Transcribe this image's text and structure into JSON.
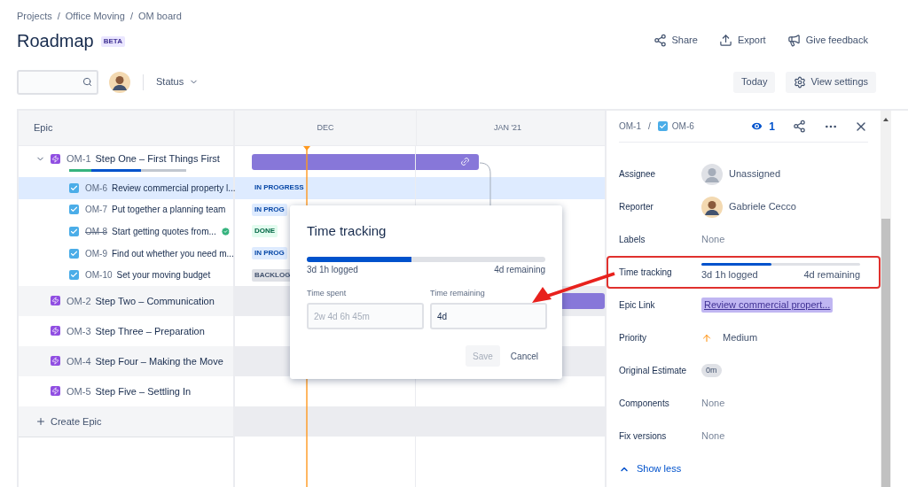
{
  "breadcrumbs": [
    "Projects",
    "Office Moving",
    "OM board"
  ],
  "breadcrumb_separators": [
    "/",
    "/"
  ],
  "title": "Roadmap",
  "badge": "BETA",
  "header_actions": [
    {
      "kind": "share",
      "label": "Share"
    },
    {
      "kind": "export",
      "label": "Export"
    },
    {
      "kind": "feedback",
      "label": "Give feedback"
    }
  ],
  "toolbar": {
    "filter": "Status",
    "buttons": [
      {
        "kind": "today",
        "label": "Today"
      },
      {
        "kind": "settings",
        "label": "View settings"
      }
    ]
  },
  "roadmap": {
    "column": "Epic",
    "months": [
      "DEC",
      "JAN '21"
    ],
    "epics": [
      {
        "key": "OM-1",
        "title": "Step One – First Things First",
        "expanded": true,
        "has_bar": true,
        "progress": [
          {
            "kind": "done",
            "level": 0.19
          },
          {
            "kind": "in_progress",
            "level": 0.42
          }
        ],
        "children": [
          {
            "key": "OM-6",
            "title": "Review commercial property l...",
            "selected": true,
            "resolved": false,
            "status": {
              "kind": "in_progress",
              "label": "IN PROGRESS"
            }
          },
          {
            "key": "OM-7",
            "title": "Put together a planning team",
            "selected": false,
            "resolved": false,
            "status": {
              "kind": "in_progress",
              "label": "IN PROG"
            }
          },
          {
            "key": "OM-8",
            "title": "Start getting quotes from...",
            "selected": false,
            "resolved": true,
            "status": {
              "kind": "done",
              "label": "DONE"
            }
          },
          {
            "key": "OM-9",
            "title": "Find out whether you need m...",
            "selected": false,
            "resolved": false,
            "status": {
              "kind": "in_progress",
              "label": "IN PROG"
            }
          },
          {
            "key": "OM-10",
            "title": "Set your moving budget",
            "selected": false,
            "resolved": false,
            "status": {
              "kind": "backlog",
              "label": "BACKLOG"
            }
          }
        ]
      },
      {
        "key": "OM-2",
        "title": "Step Two – Communication",
        "expanded": false,
        "has_bar": true
      },
      {
        "key": "OM-3",
        "title": "Step Three – Preparation",
        "expanded": false
      },
      {
        "key": "OM-4",
        "title": "Step Four – Making the Move",
        "expanded": false
      },
      {
        "key": "OM-5",
        "title": "Step Five – Settling In",
        "expanded": false
      }
    ],
    "create": "Create Epic"
  },
  "dialog": {
    "title": "Time tracking",
    "level": 0.44,
    "logged": "3d 1h logged",
    "remaining": "4d remaining",
    "fields": [
      {
        "label": "Time spent",
        "placeholder": "2w 4d 6h 45m"
      },
      {
        "label": "Time remaining",
        "value": "4d"
      }
    ],
    "buttons": [
      {
        "kind": "save",
        "label": "Save",
        "disabled": true
      },
      {
        "kind": "cancel",
        "label": "Cancel",
        "disabled": false
      }
    ]
  },
  "panel": {
    "parent": "OM-1",
    "separator": "/",
    "issue": "OM-6",
    "watchers": "1",
    "fields": [
      {
        "kind": "user",
        "label": "Assignee",
        "value": "Unassigned",
        "assigned": false
      },
      {
        "kind": "user",
        "label": "Reporter",
        "value": "Gabriele Cecco",
        "assigned": true
      },
      {
        "kind": "empty",
        "label": "Labels",
        "value": "None"
      },
      {
        "kind": "time",
        "label": "Time tracking",
        "level": 0.44,
        "logged": "3d 1h logged",
        "remaining": "4d remaining",
        "highlighted": true
      },
      {
        "kind": "link",
        "label": "Epic Link",
        "value": "Review commercial propert..."
      },
      {
        "kind": "priority",
        "label": "Priority",
        "value": "Medium"
      },
      {
        "kind": "lozenge",
        "label": "Original Estimate",
        "value": "0m"
      },
      {
        "kind": "empty",
        "label": "Components",
        "value": "None"
      },
      {
        "kind": "empty",
        "label": "Fix versions",
        "value": "None"
      }
    ],
    "toggle": "Show less"
  }
}
